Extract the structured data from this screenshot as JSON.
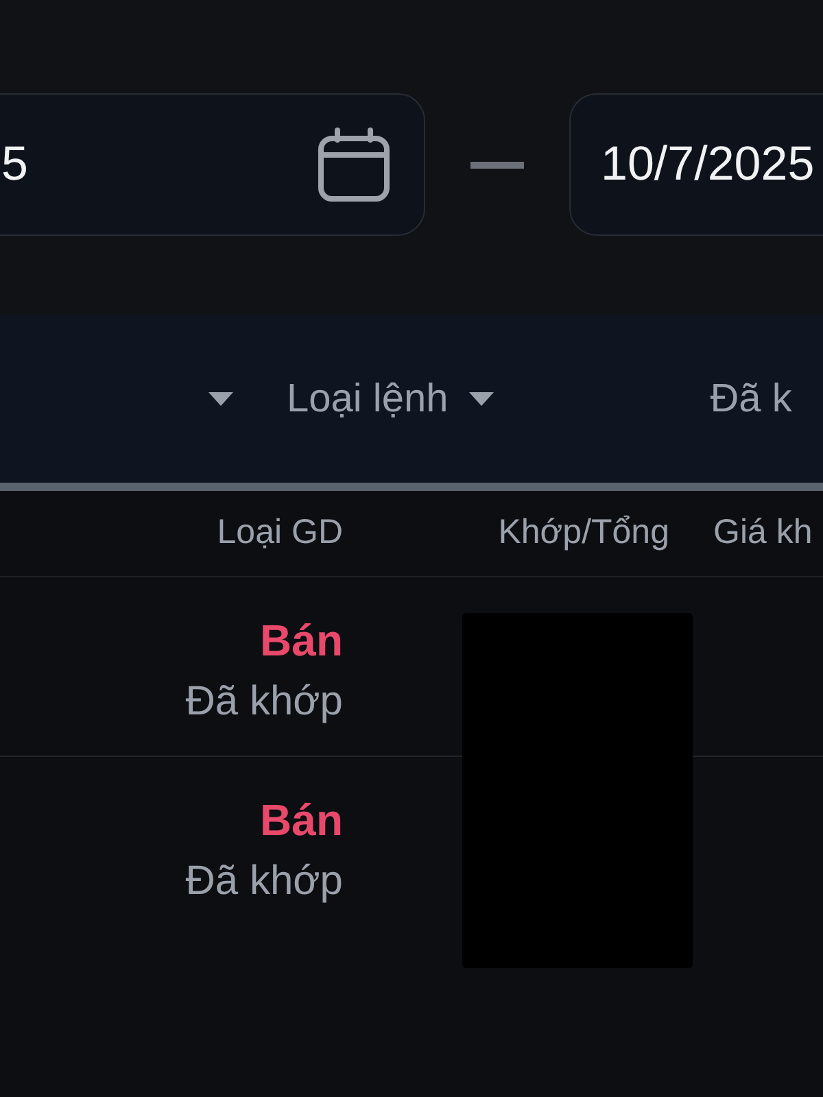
{
  "date_range": {
    "from": {
      "value": "5"
    },
    "to": {
      "value": "10/7/2025"
    }
  },
  "filters": [
    {
      "caret": true
    },
    {
      "label": "Loại lệnh",
      "caret": true
    },
    {
      "label": "Đã k",
      "caret": false
    }
  ],
  "table": {
    "columns": [
      "Loại GD",
      "Khớp/Tổng",
      "Giá kh"
    ],
    "rows": [
      {
        "trade_type": "Bán",
        "color": "#e8496b",
        "status": "Đã khớp"
      },
      {
        "trade_type": "Bán",
        "color": "#e8496b",
        "status": "Đã khớp"
      }
    ]
  }
}
